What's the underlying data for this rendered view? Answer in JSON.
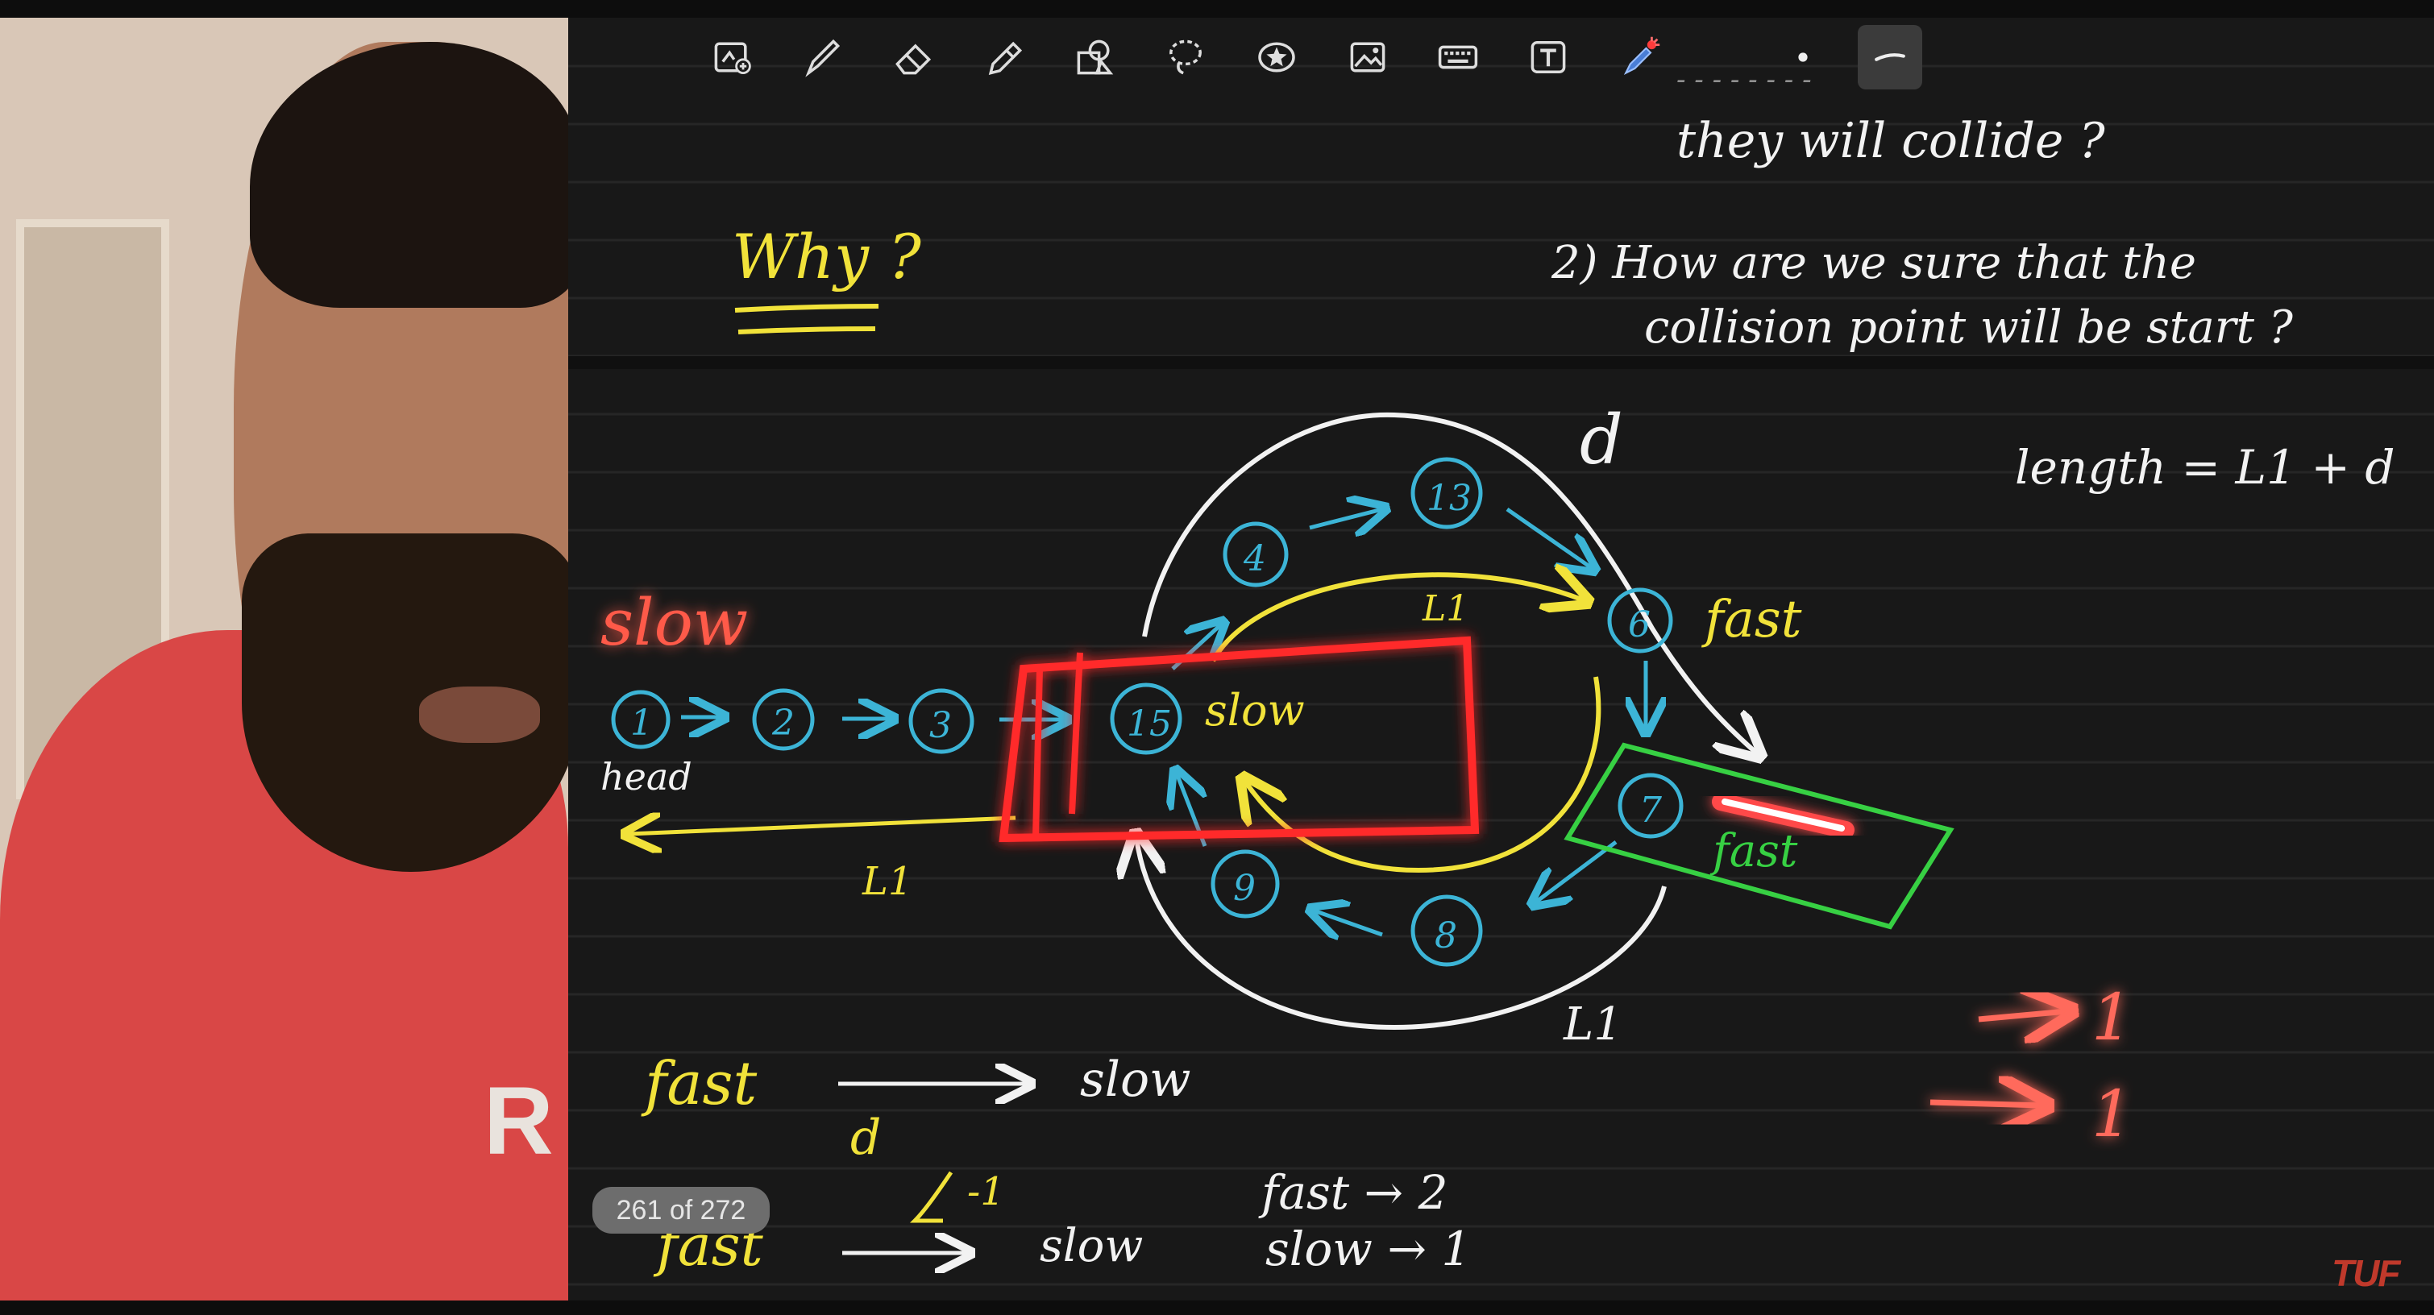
{
  "page_counter": "261 of 272",
  "watermark": "TUF",
  "shirt_logo": "R",
  "toolbar": {
    "tools": [
      "add-page-icon",
      "pen-icon",
      "eraser-icon",
      "highlighter-icon",
      "shapes-icon",
      "lasso-icon",
      "sticker-icon",
      "image-icon",
      "keyboard-icon",
      "text-icon",
      "laser-pointer-icon",
      "dot-size-icon",
      "stroke-style-icon"
    ]
  },
  "notes": {
    "q1_tail": "they will collide ?",
    "why": "Why ?",
    "q2_line1": "2) How are we sure that the",
    "q2_line2": "collision point will be start ?",
    "length_eq": "length = L1 + d",
    "d_label": "d",
    "slow_title": "slow",
    "head": "head",
    "l1_bottom": "L1",
    "l1_inner": "L1",
    "l1_ring": "L1",
    "fast_label": "fast",
    "fast_green": "fast",
    "slow_box": "slow",
    "nodes": {
      "n1": "1",
      "n2": "2",
      "n3": "3",
      "n15": "15",
      "n4": "4",
      "n13": "13",
      "n6": "6",
      "n7": "7",
      "n8": "8",
      "n9": "9"
    },
    "eq1_left": "fast",
    "eq1_right": "slow",
    "eq1_under": "d",
    "eq2_mid": "-1",
    "eq2_left": "fast",
    "eq2_right": "slow",
    "speed1": "fast → 2",
    "speed2": "slow → 1",
    "arrow_one_a": "1",
    "arrow_one_b": "1"
  },
  "colors": {
    "chalk": "#f2f2f2",
    "blue": "#3cb4d6",
    "yellow": "#f1e23a",
    "red": "#ff2b2b",
    "green": "#37d043"
  }
}
